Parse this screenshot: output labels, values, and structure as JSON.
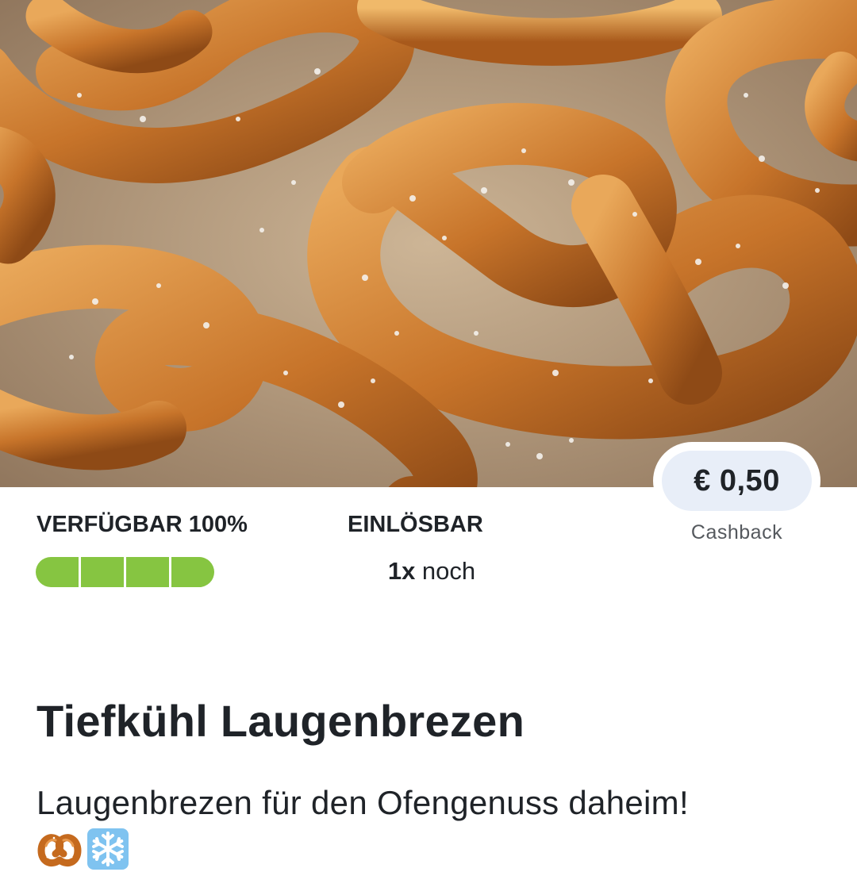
{
  "hero": {
    "image_icon": "pretzel-photo"
  },
  "cashback": {
    "amount": "€ 0,50",
    "label": "Cashback"
  },
  "availability": {
    "label": "VERFÜGBAR 100%",
    "level": 1.0,
    "segments": 4,
    "fill_color": "#86c541"
  },
  "redeemable": {
    "label": "EINLÖSBAR",
    "count": "1x",
    "count_suffix": " noch"
  },
  "product": {
    "title": "Tiefkühl Laugenbrezen",
    "description": "Laugenbrezen für den Ofengenuss daheim!",
    "emojis": [
      "pretzel-icon",
      "snowflake-icon"
    ]
  },
  "colors": {
    "pill_background": "#e8eef8",
    "text": "#1f2328",
    "muted": "#55595e"
  }
}
